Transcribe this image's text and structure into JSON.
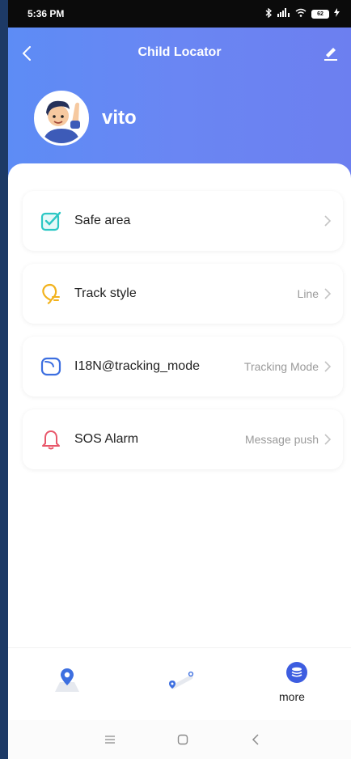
{
  "status_bar": {
    "time": "5:36 PM",
    "battery": "62",
    "icons": [
      "bluetooth-icon",
      "signal-icon",
      "wifi-icon",
      "battery-icon"
    ]
  },
  "header": {
    "title": "Child Locator",
    "username": "vito"
  },
  "settings": [
    {
      "label": "Safe area",
      "value": "",
      "icon": "checkbox-icon",
      "color": "#2cc7c4"
    },
    {
      "label": "Track style",
      "value": "Line",
      "icon": "balloon-icon",
      "color": "#f2b21c"
    },
    {
      "label": "I18N@tracking_mode",
      "value": "Tracking Mode",
      "icon": "mode-icon",
      "color": "#3d6fe0"
    },
    {
      "label": "SOS Alarm",
      "value": "Message push",
      "icon": "bell-icon",
      "color": "#e8576a"
    }
  ],
  "bottom_nav": {
    "more_label": "more"
  },
  "colors": {
    "header_start": "#5d8cf5",
    "header_end": "#6c7ff0",
    "accent": "#3d5de0"
  }
}
